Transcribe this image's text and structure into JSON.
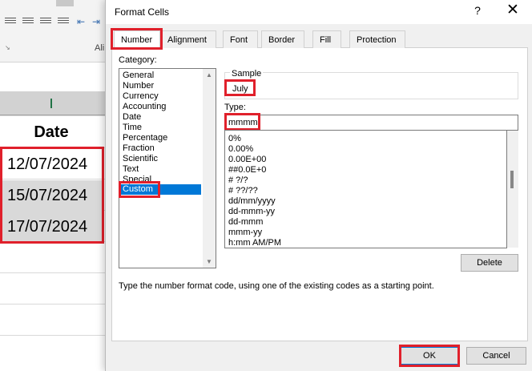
{
  "excel": {
    "ribbon_group_label": "Ali",
    "column_header": "Date",
    "cells": [
      "12/07/2024",
      "15/07/2024",
      "17/07/2024"
    ]
  },
  "dialog": {
    "title": "Format Cells",
    "help": "?",
    "close": "✕",
    "tabs": [
      "Number",
      "Alignment",
      "Font",
      "Border",
      "Fill",
      "Protection"
    ],
    "active_tab": "Number",
    "category_label": "Category:",
    "categories": [
      "General",
      "Number",
      "Currency",
      "Accounting",
      "Date",
      "Time",
      "Percentage",
      "Fraction",
      "Scientific",
      "Text",
      "Special",
      "Custom"
    ],
    "selected_category": "Custom",
    "sample_label": "Sample",
    "sample_value": "July",
    "type_label": "Type:",
    "type_value": "mmmm",
    "type_options": [
      "0%",
      "0.00%",
      "0.00E+00",
      "##0.0E+0",
      "# ?/?",
      "# ??/??",
      "dd/mm/yyyy",
      "dd-mmm-yy",
      "dd-mmm",
      "mmm-yy",
      "h:mm AM/PM"
    ],
    "delete_label": "Delete",
    "description": "Type the number format code, using one of the existing codes as a starting point.",
    "ok_label": "OK",
    "cancel_label": "Cancel"
  },
  "colors": {
    "highlight": "#e0202b",
    "selection": "#0078d7",
    "excel_green": "#217346"
  }
}
